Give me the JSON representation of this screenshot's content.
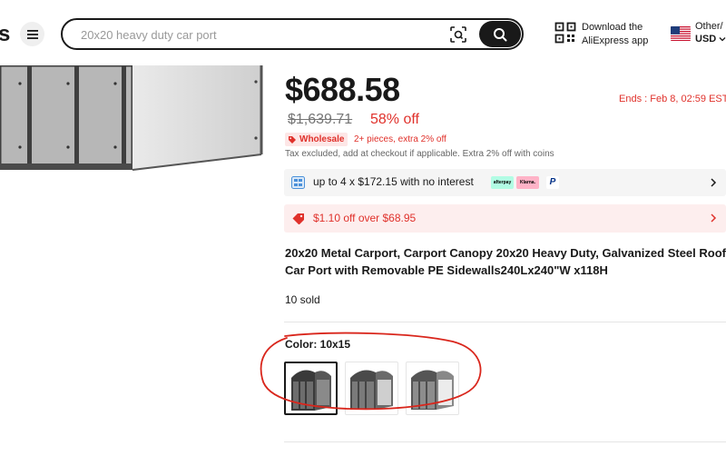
{
  "header": {
    "logo_fragment": "s",
    "search": {
      "placeholder": "20x20 heavy duty car port"
    },
    "app_download": {
      "line1": "Download the",
      "line2": "AliExpress app"
    },
    "locale": {
      "line1": "Other/",
      "currency": "USD"
    }
  },
  "product": {
    "price": "$688.58",
    "sale_ends": "Ends :  Feb 8, 02:59 EST",
    "original_price": "$1,639.71",
    "discount": "58% off",
    "wholesale_badge": "Wholesale",
    "wholesale_note": "2+ pieces, extra 2% off",
    "tax_note": "Tax excluded, add at checkout if applicable. Extra 2% off with coins",
    "installment": {
      "text": "up to 4 x $172.15 with no interest",
      "providers": [
        "afterpay",
        "Klarna.",
        "P"
      ]
    },
    "coupon": {
      "text": "$1.10 off over $68.95"
    },
    "title": "20x20 Metal Carport, Carport Canopy 20x20 Heavy Duty, Galvanized Steel Roof Car Port with Removable PE Sidewalls240Lx240\"W x118H",
    "sold": "10 sold",
    "color": {
      "label": "Color: 10x15",
      "options": 3,
      "selected_index": 0
    }
  },
  "colors": {
    "accent_red": "#e0312b",
    "dark": "#191919",
    "annotation": "#d9261c"
  }
}
